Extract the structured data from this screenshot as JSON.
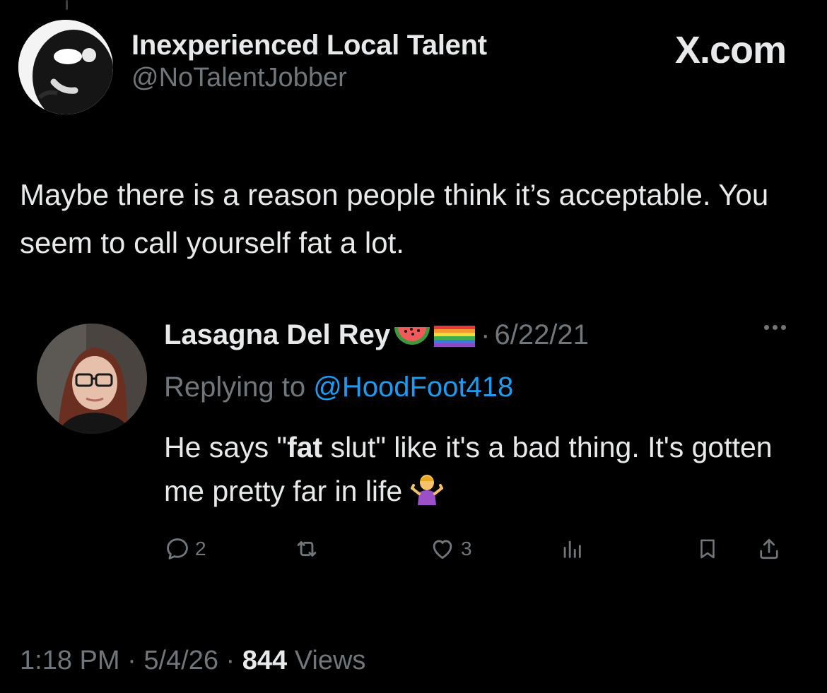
{
  "brand": {
    "label": "X.com"
  },
  "post": {
    "author_name": "Inexperienced Local Talent",
    "author_handle": "@NoTalentJobber",
    "text": "Maybe there is a reason people think it’s acceptable. You seem to call yourself fat a lot.",
    "time": "1:18 PM",
    "separator": "·",
    "date": "5/4/26",
    "views_count": "844",
    "views_label": "Views"
  },
  "quoted_post": {
    "author_name": "Lasagna Del Rey",
    "separator": "·",
    "date": "6/22/21",
    "replying_prefix": "Replying to",
    "replying_handle": "@HoodFoot418",
    "text_part1": "He says \"",
    "text_bold": "fat",
    "text_part2": " slut\" like it's a bad thing. It's gotten me pretty far in life",
    "stats": {
      "replies": "2",
      "likes": "3"
    }
  },
  "colors": {
    "background": "#000000",
    "primary_text": "#e7e9ea",
    "secondary_text": "#71767b",
    "link": "#1d9bf0"
  },
  "icons": [
    "avatar-mask",
    "avatar-person",
    "watermelon-emoji",
    "rainbow-flag-emoji",
    "more-dots-icon",
    "reply-icon",
    "retweet-icon",
    "like-icon",
    "analytics-icon",
    "bookmark-icon",
    "share-icon",
    "shrug-emoji"
  ]
}
